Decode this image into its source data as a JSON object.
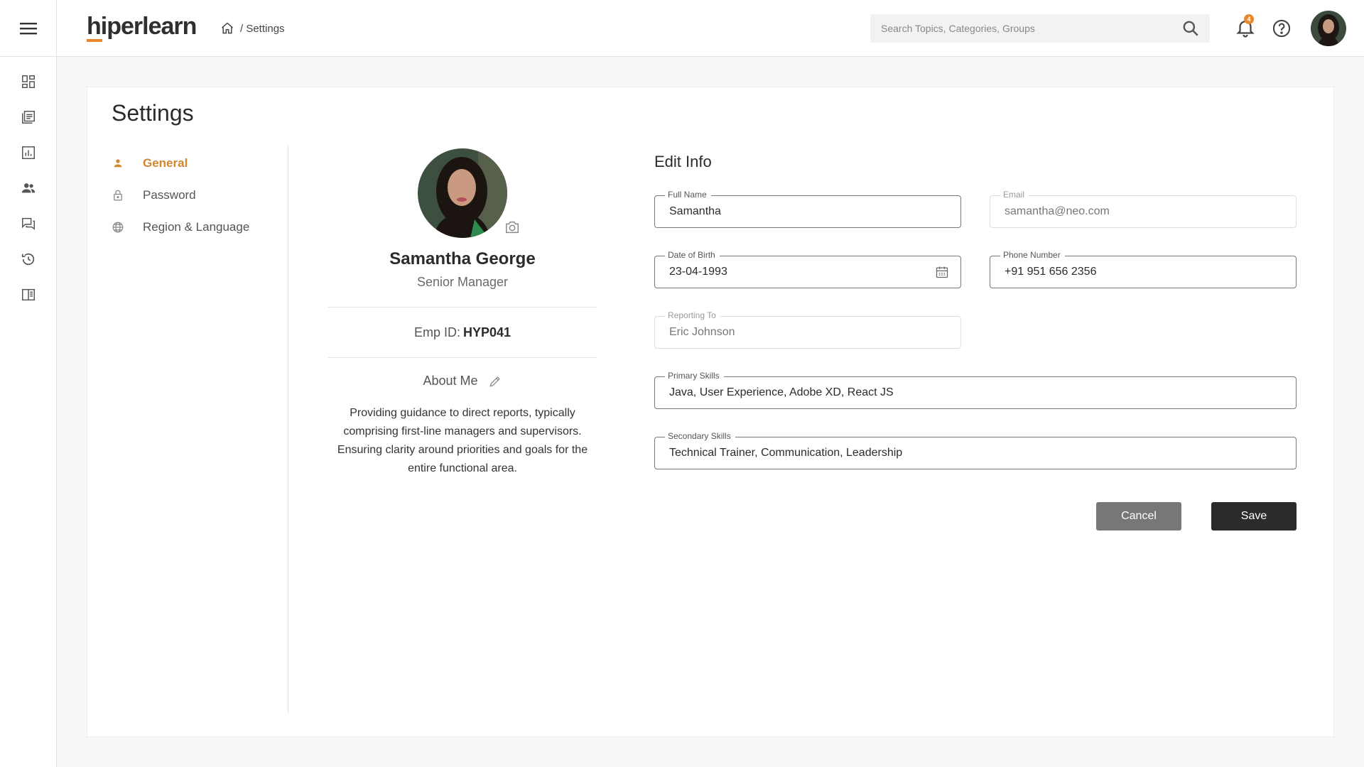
{
  "brand": {
    "logo_hi": "hi",
    "logo_rest": "perlearn",
    "accent": "#e8872b"
  },
  "breadcrumb": {
    "trail": "/ Settings"
  },
  "search": {
    "placeholder": "Search Topics, Categories, Groups"
  },
  "notifications": {
    "count": "4"
  },
  "sidebar": {
    "items": [
      {
        "icon": "dashboard-icon"
      },
      {
        "icon": "courses-icon"
      },
      {
        "icon": "reports-icon"
      },
      {
        "icon": "users-icon"
      },
      {
        "icon": "discussions-icon"
      },
      {
        "icon": "history-icon"
      },
      {
        "icon": "library-icon"
      }
    ]
  },
  "page": {
    "title": "Settings"
  },
  "settings_nav": {
    "general": "General",
    "password": "Password",
    "region": "Region & Language"
  },
  "profile": {
    "name": "Samantha George",
    "role": "Senior Manager",
    "emp_label": "Emp ID:",
    "emp_id": "HYP041",
    "about_label": "About Me",
    "about_text": "Providing guidance to direct reports, typically comprising first-line managers and supervisors. Ensuring clarity around priorities and goals for the entire functional area."
  },
  "edit_info": {
    "title": "Edit Info",
    "full_name": {
      "label": "Full Name",
      "value": "Samantha"
    },
    "email": {
      "label": "Email",
      "value": "samantha@neo.com"
    },
    "dob": {
      "label": "Date of Birth",
      "value": "23-04-1993"
    },
    "phone": {
      "label": "Phone Number",
      "value": "+91 951 656 2356"
    },
    "reporting_to": {
      "label": "Reporting To",
      "value": "Eric Johnson"
    },
    "primary_skills": {
      "label": "Primary Skills",
      "value": "Java, User Experience, Adobe XD, React JS"
    },
    "secondary_skills": {
      "label": "Secondary Skills",
      "value": "Technical Trainer, Communication, Leadership"
    }
  },
  "actions": {
    "cancel": "Cancel",
    "save": "Save"
  }
}
